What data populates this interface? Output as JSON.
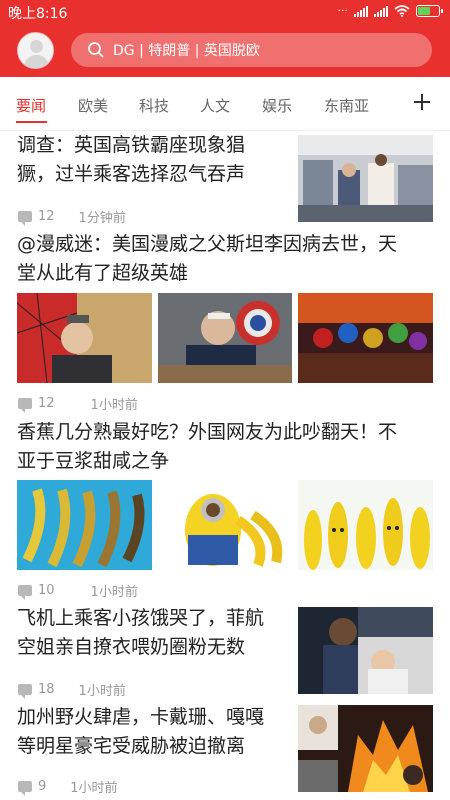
{
  "status": {
    "time": "晚上8:16"
  },
  "search": {
    "text": "DG | 特朗普 | 英国脱欧"
  },
  "tabs": [
    "要闻",
    "欧美",
    "科技",
    "人文",
    "娱乐",
    "东南亚"
  ],
  "news": [
    {
      "title_lines": [
        "调查：英国高铁霸座现象猖",
        "獗，过半乘客选择忍气吞声"
      ],
      "comments": "12",
      "time": "1分钟前"
    },
    {
      "title_lines": [
        "@漫威迷：美国漫威之父斯坦李因病去世，天",
        "堂从此有了超级英雄"
      ],
      "comments": "12",
      "time": "1小时前"
    },
    {
      "title_lines": [
        "香蕉几分熟最好吃？外国网友为此吵翻天！不",
        "亚于豆浆甜咸之争"
      ],
      "comments": "10",
      "time": "1小时前"
    },
    {
      "title_lines": [
        "飞机上乘客小孩饿哭了，菲航",
        "空姐亲自撩衣喂奶圈粉无数"
      ],
      "comments": "18",
      "time": "1小时前"
    },
    {
      "title_lines": [
        "加州野火肆虐，卡戴珊、嘎嘎",
        "等明星豪宅受威胁被迫撤离"
      ],
      "comments": "9",
      "time": "1小时前"
    }
  ],
  "colors": {
    "accent": "#e8312e",
    "search_bg": "#f07070"
  },
  "icons": [
    "avatar-icon",
    "search-icon",
    "signal-icon",
    "wifi-icon",
    "battery-icon",
    "plus-icon",
    "comment-icon"
  ]
}
